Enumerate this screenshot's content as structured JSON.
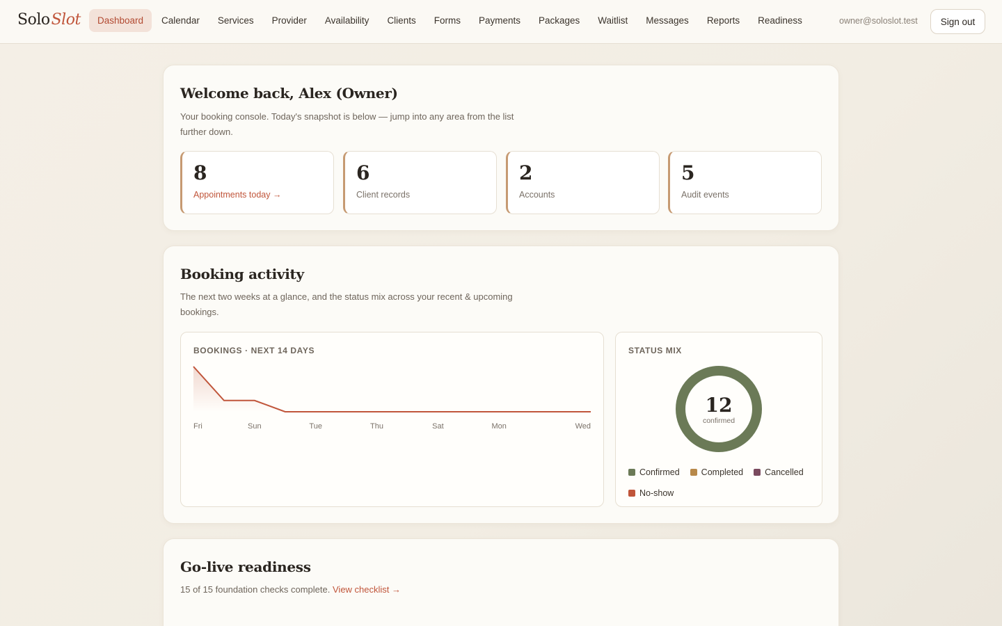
{
  "brand": {
    "part1": "Solo",
    "part2": "Slot"
  },
  "nav": [
    {
      "label": "Dashboard",
      "active": true
    },
    {
      "label": "Calendar"
    },
    {
      "label": "Services"
    },
    {
      "label": "Provider"
    },
    {
      "label": "Availability"
    },
    {
      "label": "Clients"
    },
    {
      "label": "Forms"
    },
    {
      "label": "Payments"
    },
    {
      "label": "Packages"
    },
    {
      "label": "Waitlist"
    },
    {
      "label": "Messages"
    },
    {
      "label": "Reports"
    },
    {
      "label": "Readiness"
    }
  ],
  "user": {
    "email": "owner@soloslot.test",
    "signout_label": "Sign out"
  },
  "welcome": {
    "title": "Welcome back, Alex (Owner)",
    "description": "Your booking console. Today's snapshot is below — jump into any area from the list further down.",
    "stats": [
      {
        "value": "8",
        "label": "Appointments today →",
        "link": true
      },
      {
        "value": "6",
        "label": "Client records"
      },
      {
        "value": "2",
        "label": "Accounts"
      },
      {
        "value": "5",
        "label": "Audit events"
      }
    ]
  },
  "activity": {
    "title": "Booking activity",
    "description": "The next two weeks at a glance, and the status mix across your recent & upcoming bookings.",
    "bookings_title": "BOOKINGS · NEXT 14 DAYS",
    "status_title": "STATUS MIX",
    "donut_value": "12",
    "donut_label": "confirmed",
    "legend": [
      {
        "label": "Confirmed",
        "color": "#6b7a57"
      },
      {
        "label": "Completed",
        "color": "#b8894a"
      },
      {
        "label": "Cancelled",
        "color": "#7a4a5e"
      },
      {
        "label": "No-show",
        "color": "#c0553a"
      }
    ]
  },
  "chart_data": [
    {
      "type": "area",
      "title": "BOOKINGS · NEXT 14 DAYS",
      "x": [
        "Fri",
        "Sat",
        "Sun",
        "Mon",
        "Tue",
        "Wed",
        "Thu",
        "Fri",
        "Sat",
        "Sun",
        "Mon",
        "Tue",
        "Wed",
        "Thu"
      ],
      "tick_labels": [
        "Fri",
        "Sun",
        "Tue",
        "Thu",
        "Sat",
        "Mon",
        "Wed"
      ],
      "values": [
        4,
        1,
        1,
        0,
        0,
        0,
        0,
        0,
        0,
        0,
        0,
        0,
        0,
        0
      ],
      "color": "#c0553a"
    },
    {
      "type": "pie",
      "title": "STATUS MIX",
      "categories": [
        "Confirmed",
        "Completed",
        "Cancelled",
        "No-show"
      ],
      "values": [
        12,
        0,
        0,
        0
      ],
      "colors": [
        "#6b7a57",
        "#b8894a",
        "#7a4a5e",
        "#c0553a"
      ]
    }
  ],
  "readiness": {
    "title": "Go-live readiness",
    "text": "15 of 15 foundation checks complete.",
    "link_label": "View checklist →"
  }
}
